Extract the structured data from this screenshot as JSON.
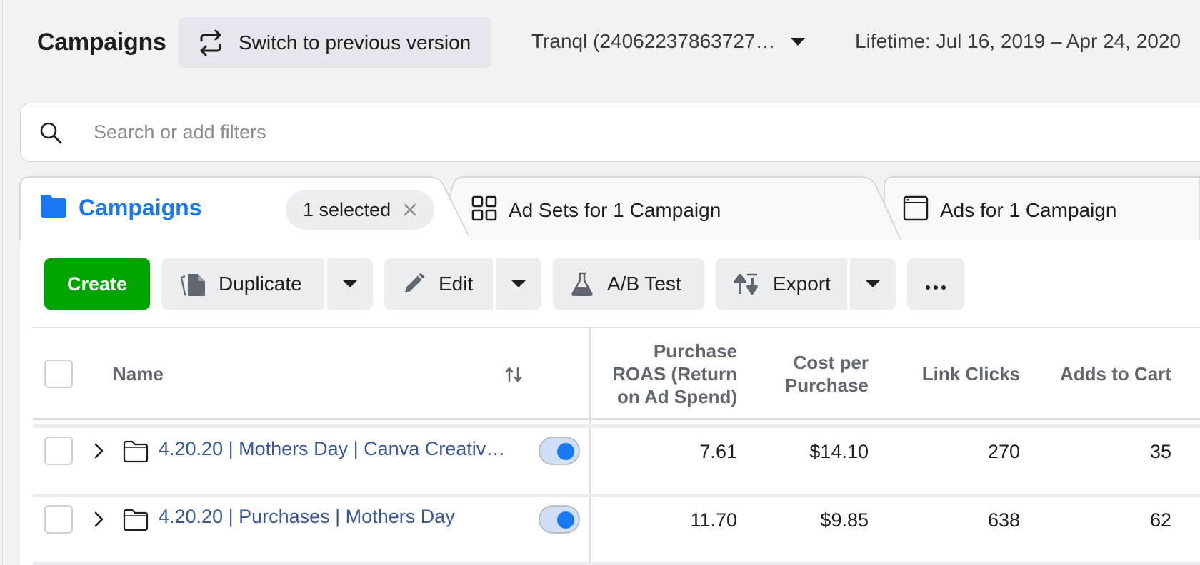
{
  "header": {
    "title": "Campaigns",
    "switch_label": "Switch to previous version",
    "account_label": "Tranql (24062237863727…",
    "date_range": "Lifetime: Jul 16, 2019 – Apr 24, 2020"
  },
  "search": {
    "placeholder": "Search or add filters"
  },
  "tabs": {
    "campaigns": {
      "label": "Campaigns",
      "selected": "1 selected"
    },
    "ad_sets": {
      "label": "Ad Sets for 1 Campaign"
    },
    "ads": {
      "label": "Ads for 1 Campaign"
    }
  },
  "toolbar": {
    "create": "Create",
    "duplicate": "Duplicate",
    "edit": "Edit",
    "ab_test": "A/B Test",
    "export": "Export"
  },
  "table": {
    "columns": {
      "name": "Name",
      "roas": "Purchase ROAS (Return on Ad Spend)",
      "cpp": "Cost per Purchase",
      "link_clicks": "Link Clicks",
      "adds_to_cart": "Adds to Cart"
    },
    "rows": [
      {
        "name": "4.20.20 | Mothers Day | Canva Creativ…",
        "roas": "7.61",
        "cpp": "$14.10",
        "link_clicks": "270",
        "adds_to_cart": "35",
        "active": true
      },
      {
        "name": "4.20.20 | Purchases | Mothers Day",
        "roas": "11.70",
        "cpp": "$9.85",
        "link_clicks": "638",
        "adds_to_cart": "62",
        "active": true
      }
    ]
  },
  "colors": {
    "accent_blue": "#1877f2",
    "link_blue": "#385898",
    "create_green": "#00a400"
  }
}
